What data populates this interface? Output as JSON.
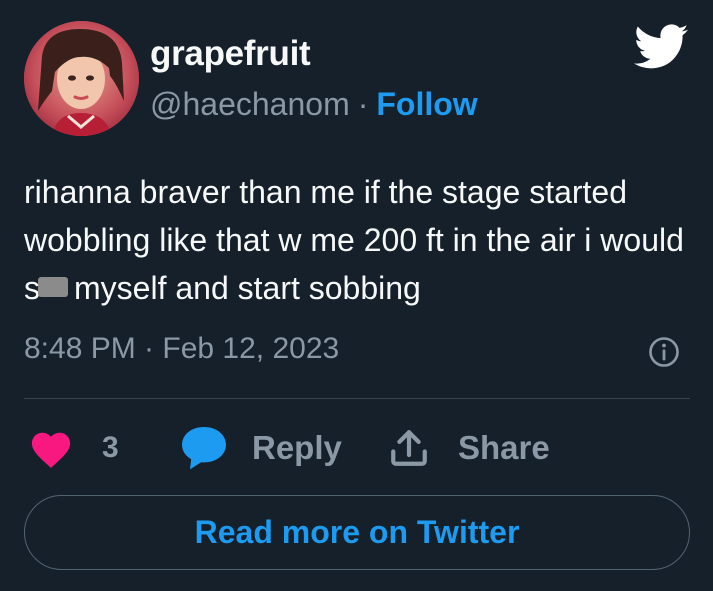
{
  "author": {
    "display_name": "grapefruit",
    "handle": "@haechanom",
    "separator": "·",
    "follow_label": "Follow"
  },
  "tweet": {
    "text_before_censor": "rihanna braver than me if the stage started wobbling like that w me 200 ft in the air i would s",
    "text_after_censor": "myself and start sobbing",
    "timestamp": "8:48 PM · Feb 12, 2023"
  },
  "actions": {
    "like_count": "3",
    "reply_label": "Reply",
    "share_label": "Share"
  },
  "footer": {
    "read_more_label": "Read more on Twitter"
  },
  "icons": {
    "brand": "twitter-bird-icon",
    "info": "info-icon",
    "like": "heart-icon",
    "reply": "speech-bubble-icon",
    "share": "share-upload-icon"
  },
  "colors": {
    "background": "#15202b",
    "primary_text": "#f7f9f9",
    "secondary_text": "#8b98a5",
    "accent": "#1d9bf0",
    "like": "#f91880",
    "border": "#38444d"
  }
}
